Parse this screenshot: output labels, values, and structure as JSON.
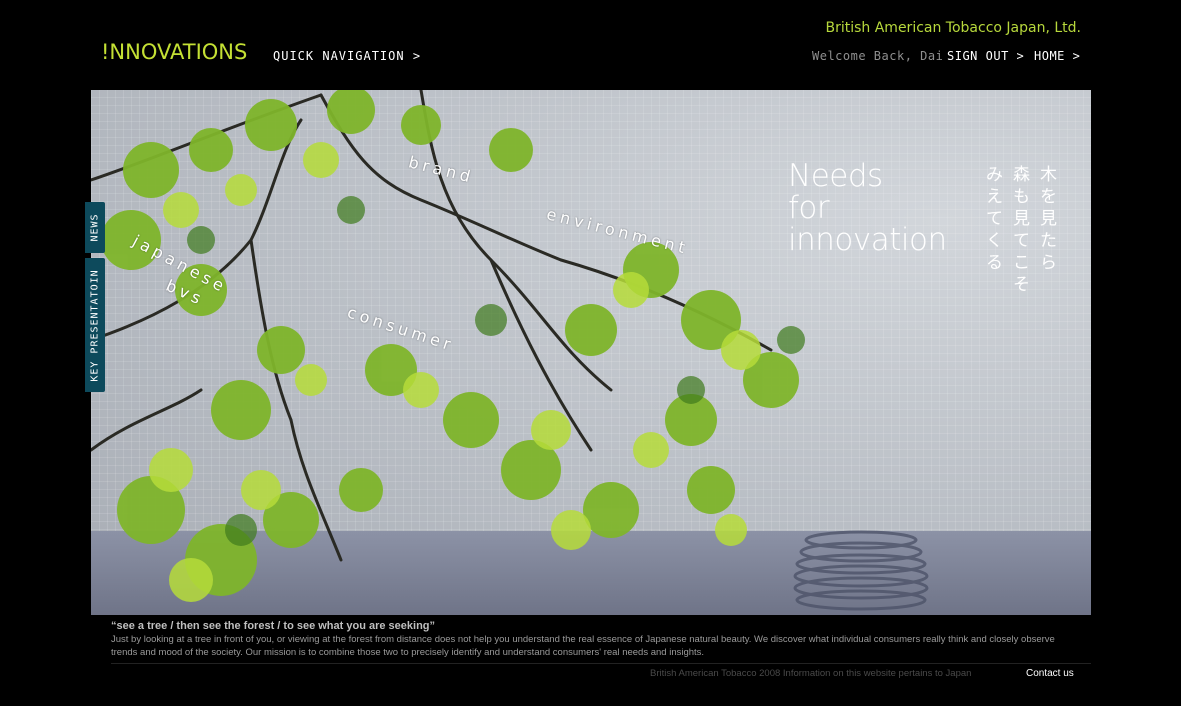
{
  "header": {
    "company": "British American Tobacco Japan, Ltd.",
    "logo": "!NNOVATIONS",
    "quick_nav": "QUICK NAVIGATION >",
    "welcome": "Welcome Back, Dai",
    "sign_out": "SIGN OUT >",
    "home": "HOME >"
  },
  "hero": {
    "keywords": {
      "brand": "brand",
      "environment": "environment",
      "japanese": "japanese",
      "bvs": "bvs",
      "consumer": "consumer"
    },
    "headline": [
      "Needs",
      "for",
      "innovation"
    ],
    "japanese_lines": [
      "木を見たら",
      "森も見てこそ",
      "みえてくる"
    ]
  },
  "side_tabs": {
    "news": "NEWS",
    "key_presentation": "KEY PRESENTATOIN"
  },
  "footer": {
    "quote": "“see a tree / then see the forest / to see what you are seeking”",
    "description": "Just by looking at a tree in front of you, or viewing at the forest from distance does not help you understand the real essence of Japanese natural beauty. We discover what individual consumers really think and closely observe trends and mood of the society. Our mission is to combine those two to precisely identify and understand consumers' real needs and insights.",
    "copyright": "British American Tobacco 2008 Information on this website pertains to Japan",
    "contact": "Contact us"
  },
  "colors": {
    "accent": "#c4e034",
    "tab_bg": "#0d4a5c",
    "background": "#000000"
  }
}
